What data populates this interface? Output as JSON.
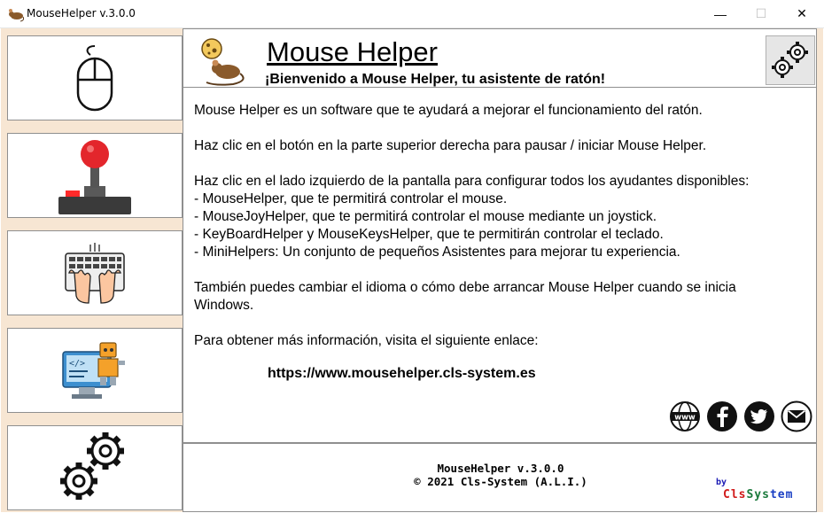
{
  "window": {
    "title": "MouseHelper v.3.0.0",
    "min_glyph": "—",
    "max_glyph": "☐",
    "close_glyph": "✕"
  },
  "sidebar": {
    "items": [
      {
        "icon": "mouse-icon",
        "name": "MouseHelper"
      },
      {
        "icon": "joystick-icon",
        "name": "MouseJoyHelper"
      },
      {
        "icon": "keyboard-icon",
        "name": "KeyBoardHelper"
      },
      {
        "icon": "robot-monitor-icon",
        "name": "MiniHelpers"
      },
      {
        "icon": "gears-icon",
        "name": "Settings"
      }
    ]
  },
  "header": {
    "title": "Mouse Helper",
    "welcome": "¡Bienvenido a Mouse Helper, tu asistente de ratón!"
  },
  "content": {
    "lines": [
      "Mouse Helper es un software que te ayudará a mejorar el funcionamiento del ratón.",
      "Haz clic en el botón en la parte superior derecha para pausar / iniciar Mouse Helper.",
      "Haz clic en el lado izquierdo de la pantalla para configurar todos los ayudantes disponibles:",
      "- MouseHelper, que te permitirá controlar el mouse.",
      "- MouseJoyHelper, que te permitirá controlar el mouse mediante un joystick.",
      "- KeyBoardHelper y MouseKeysHelper, que te permitirán controlar el teclado.",
      "- MiniHelpers: Un conjunto de pequeños Asistentes para mejorar tu experiencia.",
      "También puedes cambiar el idioma o cómo debe arrancar Mouse Helper cuando se inicia",
      "Windows.",
      "Para obtener más información, visita el siguiente enlace:"
    ],
    "link": "https://www.mousehelper.cls-system.es",
    "social": [
      "www-icon",
      "facebook-icon",
      "twitter-icon",
      "email-icon"
    ]
  },
  "footer": {
    "version": "MouseHelper v.3.0.0",
    "copyright": "©  2021 Cls-System (A.L.I.)",
    "by": "by",
    "brand_parts": [
      "Cls",
      "Sys",
      "tem"
    ]
  },
  "colors": {
    "sidebar_bg": "#f7e6d3",
    "joystick_red": "#e3262c",
    "monitor_blue": "#3d8fcf",
    "robot_orange": "#f4a12a"
  }
}
